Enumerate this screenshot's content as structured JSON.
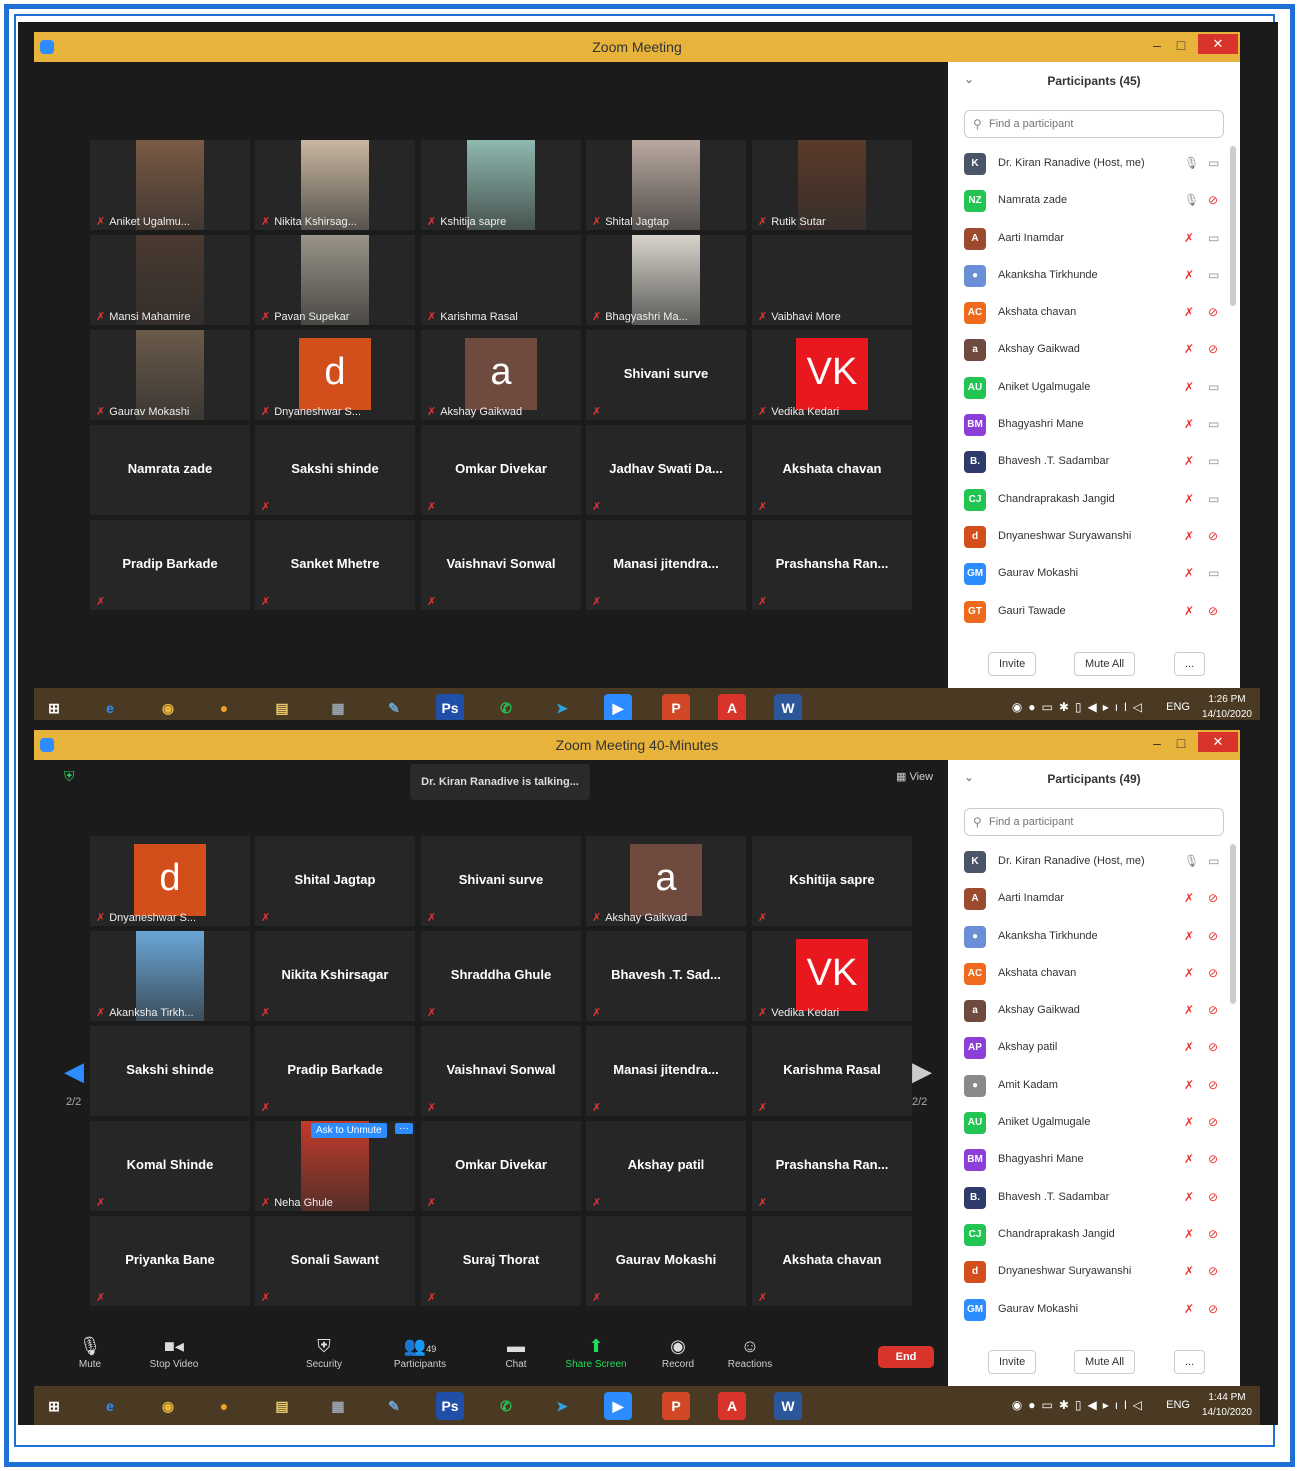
{
  "shot1": {
    "window_title": "Zoom Meeting",
    "tiles": [
      {
        "name": "Aniket Ugalmu...",
        "kind": "photo",
        "col": 0,
        "row": 0,
        "color": "#7a5a44"
      },
      {
        "name": "Nikita Kshirsag...",
        "kind": "photo",
        "col": 1,
        "row": 0,
        "color": "#c9b7a2"
      },
      {
        "name": "Kshitija sapre",
        "kind": "photo",
        "col": 2,
        "row": 0,
        "color": "#8fb9b0"
      },
      {
        "name": "Shital Jagtap",
        "kind": "photo",
        "col": 3,
        "row": 0,
        "color": "#b9a9a0"
      },
      {
        "name": "Rutik Sutar",
        "kind": "photo",
        "col": 4,
        "row": 0,
        "color": "#5a3a2a"
      },
      {
        "name": "Mansi Mahamire",
        "kind": "photo",
        "col": 0,
        "row": 1,
        "color": "#4a3a30"
      },
      {
        "name": "Pavan Supekar",
        "kind": "photo",
        "col": 1,
        "row": 1,
        "color": "#9a9488"
      },
      {
        "name": "Karishma Rasal",
        "kind": "small",
        "col": 2,
        "row": 1
      },
      {
        "name": "Bhagyashri Ma...",
        "kind": "photo",
        "col": 3,
        "row": 1,
        "color": "#d8d4cc"
      },
      {
        "name": "Vaibhavi More",
        "kind": "small",
        "col": 4,
        "row": 1
      },
      {
        "name": "Gaurav Mokashi",
        "kind": "photo",
        "col": 0,
        "row": 2,
        "color": "#6a5a4a"
      },
      {
        "name": "Dnyaneshwar S...",
        "kind": "avatar",
        "letter": "d",
        "avatar_color": "#d24e1b",
        "col": 1,
        "row": 2
      },
      {
        "name": "Akshay Gaikwad",
        "kind": "avatar",
        "letter": "a",
        "avatar_color": "#6f4a3e",
        "col": 2,
        "row": 2
      },
      {
        "name": "Shivani surve",
        "kind": "center",
        "col": 3,
        "row": 2
      },
      {
        "name": "Vedika Kedari",
        "kind": "avatar",
        "letter": "VK",
        "avatar_color": "#e8181e",
        "col": 4,
        "row": 2
      },
      {
        "name": "Namrata zade",
        "kind": "center",
        "nomic": true,
        "col": 0,
        "row": 3
      },
      {
        "name": "Sakshi shinde",
        "kind": "center",
        "col": 1,
        "row": 3
      },
      {
        "name": "Omkar Divekar",
        "kind": "center",
        "col": 2,
        "row": 3
      },
      {
        "name": "Jadhav Swati Da...",
        "kind": "center",
        "col": 3,
        "row": 3
      },
      {
        "name": "Akshata chavan",
        "kind": "center",
        "col": 4,
        "row": 3
      },
      {
        "name": "Pradip Barkade",
        "kind": "center",
        "col": 0,
        "row": 4
      },
      {
        "name": "Sanket Mhetre",
        "kind": "center",
        "col": 1,
        "row": 4
      },
      {
        "name": "Vaishnavi Sonwal",
        "kind": "center",
        "col": 2,
        "row": 4
      },
      {
        "name": "Manasi jitendra...",
        "kind": "center",
        "col": 3,
        "row": 4
      },
      {
        "name": "Prashansha Ran...",
        "kind": "center",
        "col": 4,
        "row": 4
      }
    ],
    "participants_title": "Participants (45)",
    "search_placeholder": "Find a participant",
    "participants": [
      {
        "initials": "K",
        "name": "Dr. Kiran Ranadive (Host, me)",
        "color": "#4a5568",
        "mic": "on",
        "cam": "on"
      },
      {
        "initials": "NZ",
        "name": "Namrata zade",
        "color": "#23c552",
        "mic": "on",
        "cam": "off"
      },
      {
        "initials": "A",
        "name": "Aarti Inamdar",
        "color": "#9c4a2e",
        "mic": "off",
        "cam": "on"
      },
      {
        "initials": "",
        "name": "Akanksha Tirkhunde",
        "color": "#6b8fd6",
        "mic": "off",
        "cam": "on"
      },
      {
        "initials": "AC",
        "name": "Akshata chavan",
        "color": "#f06a1e",
        "mic": "off",
        "cam": "off"
      },
      {
        "initials": "a",
        "name": "Akshay Gaikwad",
        "color": "#6f4a3e",
        "mic": "off",
        "cam": "off"
      },
      {
        "initials": "AU",
        "name": "Aniket Ugalmugale",
        "color": "#23c552",
        "mic": "off",
        "cam": "on"
      },
      {
        "initials": "BM",
        "name": "Bhagyashri Mane",
        "color": "#8b3fd6",
        "mic": "off",
        "cam": "on"
      },
      {
        "initials": "B.",
        "name": "Bhavesh .T. Sadambar",
        "color": "#2d3a6b",
        "mic": "off",
        "cam": "on"
      },
      {
        "initials": "CJ",
        "name": "Chandraprakash Jangid",
        "color": "#23c552",
        "mic": "off",
        "cam": "on"
      },
      {
        "initials": "d",
        "name": "Dnyaneshwar Suryawanshi",
        "color": "#d24e1b",
        "mic": "off",
        "cam": "off"
      },
      {
        "initials": "GM",
        "name": "Gaurav Mokashi",
        "color": "#2d8cff",
        "mic": "off",
        "cam": "on"
      },
      {
        "initials": "GT",
        "name": "Gauri Tawade",
        "color": "#f06a1e",
        "mic": "off",
        "cam": "off"
      }
    ],
    "invite_label": "Invite",
    "mute_all_label": "Mute All",
    "more_label": "...",
    "clock_time": "1:26 PM",
    "clock_date": "14/10/2020",
    "lang": "ENG"
  },
  "shot2": {
    "window_title": "Zoom Meeting 40-Minutes",
    "talking_label": "Dr. Kiran Ranadive is talking...",
    "view_label": "View",
    "page_left": "2/2",
    "page_right": "2/2",
    "ask_unmute_label": "Ask to Unmute",
    "ask_unmute_more": "···",
    "tiles": [
      {
        "name": "Dnyaneshwar S...",
        "kind": "avatar",
        "letter": "d",
        "avatar_color": "#d24e1b",
        "col": 0,
        "row": 0
      },
      {
        "name": "Shital Jagtap",
        "kind": "center",
        "col": 1,
        "row": 0
      },
      {
        "name": "Shivani surve",
        "kind": "center",
        "col": 2,
        "row": 0
      },
      {
        "name": "Akshay Gaikwad",
        "kind": "avatar",
        "letter": "a",
        "avatar_color": "#6f4a3e",
        "col": 3,
        "row": 0
      },
      {
        "name": "Kshitija sapre",
        "kind": "center",
        "col": 4,
        "row": 0
      },
      {
        "name": "Akanksha Tirkh...",
        "kind": "photo",
        "color": "#6aa6d6",
        "col": 0,
        "row": 1
      },
      {
        "name": "Nikita Kshirsagar",
        "kind": "center",
        "col": 1,
        "row": 1
      },
      {
        "name": "Shraddha Ghule",
        "kind": "center",
        "col": 2,
        "row": 1
      },
      {
        "name": "Bhavesh .T. Sad...",
        "kind": "center",
        "col": 3,
        "row": 1
      },
      {
        "name": "Vedika Kedari",
        "kind": "avatar",
        "letter": "VK",
        "avatar_color": "#e8181e",
        "col": 4,
        "row": 1
      },
      {
        "name": "Sakshi shinde",
        "kind": "center",
        "nomic": true,
        "col": 0,
        "row": 2
      },
      {
        "name": "Pradip Barkade",
        "kind": "center",
        "col": 1,
        "row": 2
      },
      {
        "name": "Vaishnavi Sonwal",
        "kind": "center",
        "col": 2,
        "row": 2
      },
      {
        "name": "Manasi jitendra...",
        "kind": "center",
        "col": 3,
        "row": 2
      },
      {
        "name": "Karishma Rasal",
        "kind": "center",
        "col": 4,
        "row": 2
      },
      {
        "name": "Komal Shinde",
        "kind": "center",
        "col": 0,
        "row": 3
      },
      {
        "name": "Neha Ghule",
        "kind": "photo",
        "color": "#c23a2a",
        "col": 1,
        "row": 3
      },
      {
        "name": "Omkar Divekar",
        "kind": "center",
        "col": 2,
        "row": 3
      },
      {
        "name": "Akshay patil",
        "kind": "center",
        "col": 3,
        "row": 3
      },
      {
        "name": "Prashansha Ran...",
        "kind": "center",
        "col": 4,
        "row": 3
      },
      {
        "name": "Priyanka Bane",
        "kind": "center",
        "col": 0,
        "row": 4
      },
      {
        "name": "Sonali Sawant",
        "kind": "center",
        "col": 1,
        "row": 4
      },
      {
        "name": "Suraj Thorat",
        "kind": "center",
        "col": 2,
        "row": 4
      },
      {
        "name": "Gaurav Mokashi",
        "kind": "center",
        "col": 3,
        "row": 4
      },
      {
        "name": "Akshata chavan",
        "kind": "center",
        "col": 4,
        "row": 4
      }
    ],
    "toolbar": {
      "mute": "Mute",
      "stop_video": "Stop Video",
      "security": "Security",
      "participants": "Participants",
      "participants_count": "49",
      "chat": "Chat",
      "share_screen": "Share Screen",
      "record": "Record",
      "reactions": "Reactions",
      "end": "End"
    },
    "participants_title": "Participants (49)",
    "search_placeholder": "Find a participant",
    "participants": [
      {
        "initials": "K",
        "name": "Dr. Kiran Ranadive (Host, me)",
        "color": "#4a5568",
        "mic": "on",
        "cam": "on"
      },
      {
        "initials": "A",
        "name": "Aarti Inamdar",
        "color": "#9c4a2e",
        "mic": "off",
        "cam": "off"
      },
      {
        "initials": "",
        "name": "Akanksha Tirkhunde",
        "color": "#6b8fd6",
        "mic": "off",
        "cam": "off"
      },
      {
        "initials": "AC",
        "name": "Akshata chavan",
        "color": "#f06a1e",
        "mic": "off",
        "cam": "off"
      },
      {
        "initials": "a",
        "name": "Akshay Gaikwad",
        "color": "#6f4a3e",
        "mic": "off",
        "cam": "off"
      },
      {
        "initials": "AP",
        "name": "Akshay patil",
        "color": "#8b3fd6",
        "mic": "off",
        "cam": "off"
      },
      {
        "initials": "",
        "name": "Amit Kadam",
        "color": "#8a8a8a",
        "mic": "off",
        "cam": "off"
      },
      {
        "initials": "AU",
        "name": "Aniket Ugalmugale",
        "color": "#23c552",
        "mic": "off",
        "cam": "off"
      },
      {
        "initials": "BM",
        "name": "Bhagyashri Mane",
        "color": "#8b3fd6",
        "mic": "off",
        "cam": "off"
      },
      {
        "initials": "B.",
        "name": "Bhavesh .T. Sadambar",
        "color": "#2d3a6b",
        "mic": "off",
        "cam": "off"
      },
      {
        "initials": "CJ",
        "name": "Chandraprakash Jangid",
        "color": "#23c552",
        "mic": "off",
        "cam": "off"
      },
      {
        "initials": "d",
        "name": "Dnyaneshwar Suryawanshi",
        "color": "#d24e1b",
        "mic": "off",
        "cam": "off"
      },
      {
        "initials": "GM",
        "name": "Gaurav Mokashi",
        "color": "#2d8cff",
        "mic": "off",
        "cam": "off"
      }
    ],
    "invite_label": "Invite",
    "mute_all_label": "Mute All",
    "more_label": "...",
    "clock_time": "1:44 PM",
    "clock_date": "14/10/2020",
    "lang": "ENG"
  },
  "taskbar_apps": [
    {
      "icon": "windows-start-icon",
      "color": "#ffffff",
      "glyph": "⊞"
    },
    {
      "icon": "internet-explorer-icon",
      "color": "#2d8cff",
      "glyph": "e"
    },
    {
      "icon": "chrome-icon",
      "color": "#e8b33a",
      "glyph": "◉"
    },
    {
      "icon": "app-orb-icon",
      "color": "#f0a020",
      "glyph": "●"
    },
    {
      "icon": "file-explorer-icon",
      "color": "#e8c66a",
      "glyph": "▤"
    },
    {
      "icon": "calculator-icon",
      "color": "#9aa4b0",
      "glyph": "▦"
    },
    {
      "icon": "paint-icon",
      "color": "#6aa6d6",
      "glyph": "✎"
    },
    {
      "icon": "photoshop-icon",
      "color": "#1f4fa8",
      "glyph": "Ps"
    },
    {
      "icon": "whatsapp-icon",
      "color": "#23c552",
      "glyph": "✆"
    },
    {
      "icon": "telegram-icon",
      "color": "#2aa3e0",
      "glyph": "➤"
    },
    {
      "icon": "zoom-icon",
      "color": "#2d8cff",
      "glyph": "▶"
    },
    {
      "icon": "powerpoint-icon",
      "color": "#d24726",
      "glyph": "P"
    },
    {
      "icon": "acrobat-icon",
      "color": "#d9342b",
      "glyph": "A"
    },
    {
      "icon": "word-icon",
      "color": "#2b579a",
      "glyph": "W"
    }
  ]
}
